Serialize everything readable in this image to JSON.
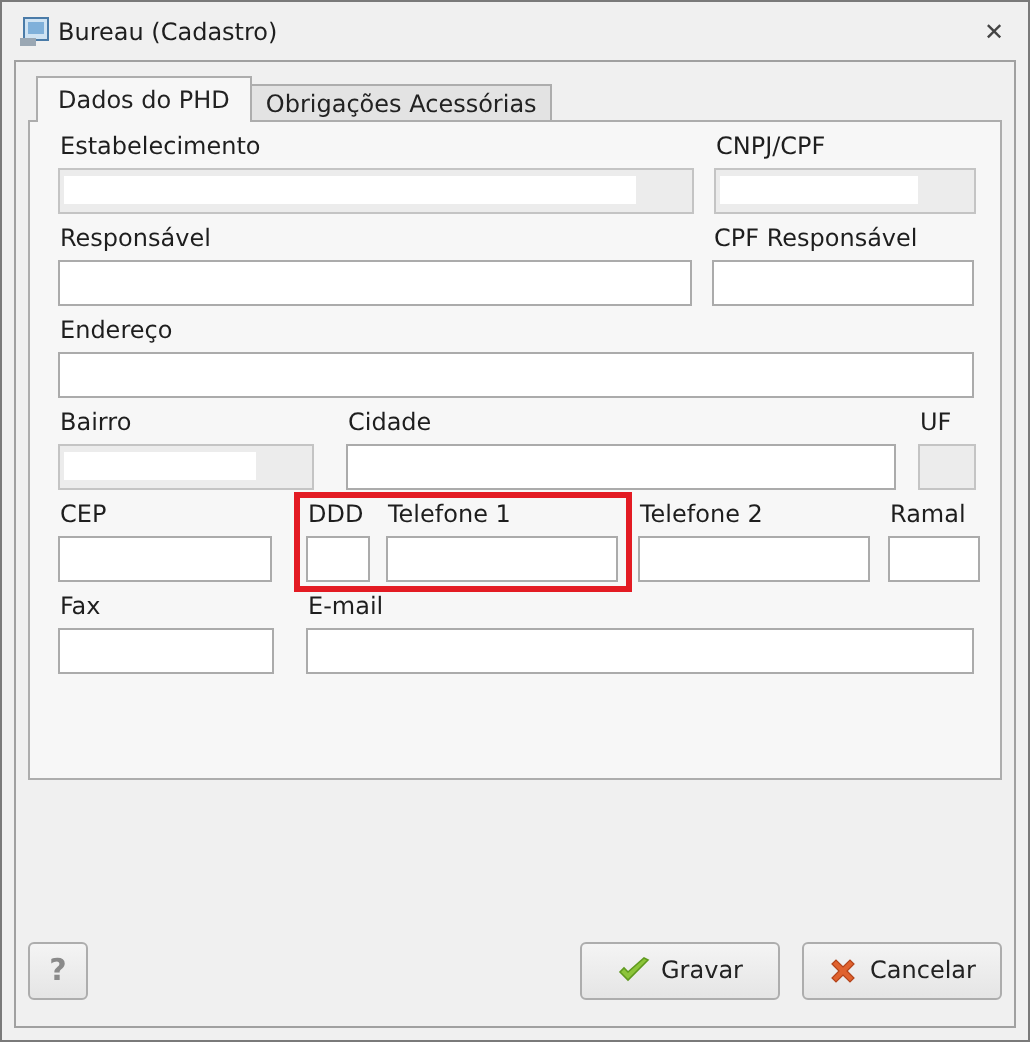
{
  "window": {
    "title": "Bureau (Cadastro)",
    "close": "✕"
  },
  "tabs": [
    {
      "label": "Dados do PHD",
      "selected": true
    },
    {
      "label": "Obrigações Acessórias",
      "selected": false
    }
  ],
  "form_rows": [
    [
      {
        "label": "Estabelecimento",
        "disabled": true,
        "highlighted": false
      },
      {
        "label": "CNPJ/CPF",
        "disabled": true,
        "highlighted": false
      }
    ],
    [
      {
        "label": "Responsável",
        "disabled": false,
        "highlighted": false
      },
      {
        "label": "CPF Responsável",
        "disabled": false,
        "highlighted": false
      }
    ],
    [
      {
        "label": "Endereço",
        "disabled": false,
        "highlighted": false
      }
    ],
    [
      {
        "label": "Bairro",
        "disabled": true,
        "highlighted": false
      },
      {
        "label": "Cidade",
        "disabled": false,
        "highlighted": false
      },
      {
        "label": "UF",
        "disabled": true,
        "highlighted": false
      }
    ],
    [
      {
        "label": "CEP",
        "disabled": false,
        "highlighted": false
      },
      {
        "label": "DDD",
        "disabled": false,
        "highlighted": true
      },
      {
        "label": "Telefone 1",
        "disabled": false,
        "highlighted": true
      },
      {
        "label": "Telefone 2",
        "disabled": false,
        "highlighted": false
      },
      {
        "label": "Ramal",
        "disabled": false,
        "highlighted": false
      }
    ],
    [
      {
        "label": "Fax",
        "disabled": false,
        "highlighted": false
      },
      {
        "label": "E-mail",
        "disabled": false,
        "highlighted": false
      }
    ]
  ],
  "buttons": [
    {
      "kind": "help",
      "label": "?"
    },
    {
      "kind": "save",
      "label": "Gravar"
    },
    {
      "kind": "cancel",
      "label": "Cancelar"
    }
  ]
}
